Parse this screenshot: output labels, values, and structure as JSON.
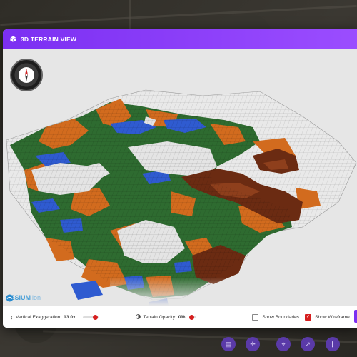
{
  "modal": {
    "title": "3D TERRAIN VIEW",
    "header_icon": "cube-icon",
    "accent_color": "#7b2ff2"
  },
  "viewer": {
    "compass_icon": "compass-icon",
    "attribution": {
      "brand": "CESIUM",
      "suffix": "ion"
    }
  },
  "controls": {
    "vertical_exaggeration": {
      "label": "Vertical Exaggeration:",
      "value": "13.0x",
      "icon": "vertical-arrows-icon"
    },
    "terrain_opacity": {
      "label": "Terrain Opacity:",
      "value": "0%",
      "icon": "half-circle-icon"
    },
    "show_boundaries": {
      "label": "Show Boundaries",
      "checked": false
    },
    "show_wireframe": {
      "label": "Show Wireframe",
      "checked": true
    }
  },
  "colors": {
    "forest": "#2e6b30",
    "orange": "#d26b1e",
    "water": "#2f5bd0",
    "brown": "#6b2b12",
    "accent_red": "#d61f1f"
  },
  "bottom_toolbar": {
    "buttons": [
      "layers-icon",
      "target-icon",
      "tool-icon",
      "expand-icon",
      "frame-icon"
    ]
  }
}
